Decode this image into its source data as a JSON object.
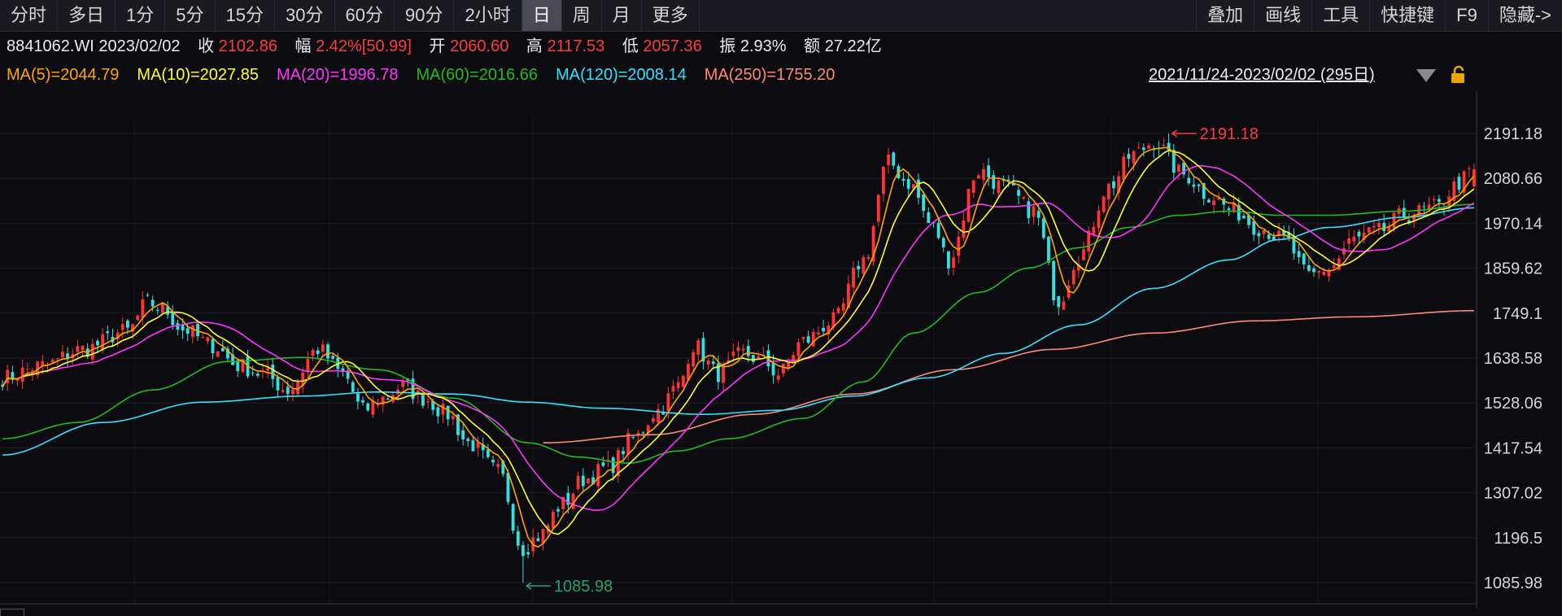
{
  "toolbar": {
    "periods": [
      "分时",
      "多日",
      "1分",
      "5分",
      "15分",
      "30分",
      "60分",
      "90分",
      "2小时",
      "日",
      "周",
      "月",
      "更多"
    ],
    "active_period": "日",
    "tools": [
      "叠加",
      "画线",
      "工具",
      "快捷键",
      "F9",
      "隐藏->"
    ]
  },
  "quote": {
    "code_date": "8841062.WI 2023/02/02",
    "close_label": "收",
    "close": "2102.86",
    "change_label": "幅",
    "change": "2.42%[50.99]",
    "open_label": "开",
    "open": "2060.60",
    "high_label": "高",
    "high": "2117.53",
    "low_label": "低",
    "low": "2057.36",
    "amp_label": "振",
    "amp": "2.93%",
    "amount_label": "额",
    "amount": "27.22亿"
  },
  "ma_labels": [
    {
      "text": "MA(5)=2044.79",
      "color": "#ffa500"
    },
    {
      "text": "MA(10)=2027.85",
      "color": "#ffff33"
    },
    {
      "text": "MA(20)=1996.78",
      "color": "#ff33ff"
    },
    {
      "text": "MA(60)=2016.66",
      "color": "#22bb22"
    },
    {
      "text": "MA(120)=2008.14",
      "color": "#33e0ff"
    },
    {
      "text": "MA(250)=1755.20",
      "color": "#ff8877"
    }
  ],
  "date_range": "2021/11/24-2023/02/02 (295日)",
  "chart_data": {
    "type": "candlestick",
    "y_ticks": [
      "2191.18",
      "2080.66",
      "1970.14",
      "1859.62",
      "1749.1",
      "1638.58",
      "1528.06",
      "1417.54",
      "1307.02",
      "1196.5",
      "1085.98"
    ],
    "ylim": [
      1085.98,
      2191.18
    ],
    "bar_count": 295,
    "high_annotation": "2191.18",
    "low_annotation": "1085.98",
    "colors": {
      "up": "#ff3333",
      "down": "#33e0e0",
      "ma5": "#ffa500",
      "ma10": "#ffff33",
      "ma20": "#ff33ff",
      "ma60": "#22bb22",
      "ma120": "#33e0ff",
      "ma250": "#ff8877"
    },
    "close_anchors": [
      [
        0,
        1590
      ],
      [
        8,
        1620
      ],
      [
        16,
        1660
      ],
      [
        25,
        1705
      ],
      [
        29,
        1775
      ],
      [
        32,
        1760
      ],
      [
        36,
        1710
      ],
      [
        42,
        1670
      ],
      [
        47,
        1620
      ],
      [
        52,
        1600
      ],
      [
        57,
        1560
      ],
      [
        63,
        1660
      ],
      [
        68,
        1600
      ],
      [
        72,
        1510
      ],
      [
        76,
        1540
      ],
      [
        80,
        1570
      ],
      [
        84,
        1540
      ],
      [
        89,
        1500
      ],
      [
        93,
        1430
      ],
      [
        99,
        1360
      ],
      [
        104,
        1170
      ],
      [
        107,
        1200
      ],
      [
        112,
        1280
      ],
      [
        116,
        1340
      ],
      [
        121,
        1370
      ],
      [
        126,
        1440
      ],
      [
        131,
        1510
      ],
      [
        135,
        1570
      ],
      [
        138,
        1670
      ],
      [
        143,
        1600
      ],
      [
        148,
        1650
      ],
      [
        152,
        1630
      ],
      [
        155,
        1600
      ],
      [
        160,
        1680
      ],
      [
        166,
        1730
      ],
      [
        172,
        1880
      ],
      [
        177,
        2120
      ],
      [
        181,
        2070
      ],
      [
        186,
        1960
      ],
      [
        189,
        1880
      ],
      [
        195,
        2100
      ],
      [
        200,
        2060
      ],
      [
        206,
        2000
      ],
      [
        211,
        1780
      ],
      [
        215,
        1890
      ],
      [
        221,
        2060
      ],
      [
        226,
        2140
      ],
      [
        230,
        2170
      ],
      [
        236,
        2090
      ],
      [
        241,
        2040
      ],
      [
        246,
        2000
      ],
      [
        251,
        1960
      ],
      [
        256,
        1930
      ],
      [
        261,
        1840
      ],
      [
        265,
        1860
      ],
      [
        270,
        1930
      ],
      [
        275,
        1950
      ],
      [
        280,
        1990
      ],
      [
        287,
        2010
      ],
      [
        290,
        2060
      ],
      [
        292,
        2080
      ],
      [
        294,
        2102.86
      ]
    ],
    "ma60_anchors": [
      [
        0,
        1440
      ],
      [
        15,
        1480
      ],
      [
        30,
        1560
      ],
      [
        45,
        1630
      ],
      [
        60,
        1640
      ],
      [
        75,
        1610
      ],
      [
        90,
        1540
      ],
      [
        105,
        1430
      ],
      [
        115,
        1395
      ],
      [
        125,
        1380
      ],
      [
        135,
        1410
      ],
      [
        145,
        1440
      ],
      [
        160,
        1490
      ],
      [
        172,
        1580
      ],
      [
        182,
        1700
      ],
      [
        195,
        1800
      ],
      [
        205,
        1860
      ],
      [
        215,
        1910
      ],
      [
        225,
        1960
      ],
      [
        235,
        1990
      ],
      [
        245,
        2000
      ],
      [
        255,
        1990
      ],
      [
        265,
        1990
      ],
      [
        280,
        2000
      ],
      [
        294,
        2016.66
      ]
    ],
    "ma120_anchors": [
      [
        0,
        1400
      ],
      [
        20,
        1480
      ],
      [
        40,
        1530
      ],
      [
        60,
        1545
      ],
      [
        75,
        1555
      ],
      [
        90,
        1550
      ],
      [
        105,
        1530
      ],
      [
        120,
        1515
      ],
      [
        140,
        1500
      ],
      [
        155,
        1510
      ],
      [
        170,
        1545
      ],
      [
        185,
        1590
      ],
      [
        200,
        1650
      ],
      [
        215,
        1720
      ],
      [
        230,
        1810
      ],
      [
        245,
        1880
      ],
      [
        255,
        1930
      ],
      [
        265,
        1960
      ],
      [
        280,
        1985
      ],
      [
        294,
        2008.14
      ]
    ],
    "ma250_anchors": [
      [
        108,
        1430
      ],
      [
        130,
        1450
      ],
      [
        150,
        1500
      ],
      [
        170,
        1550
      ],
      [
        190,
        1610
      ],
      [
        210,
        1660
      ],
      [
        230,
        1700
      ],
      [
        250,
        1730
      ],
      [
        270,
        1740
      ],
      [
        294,
        1755.2
      ]
    ]
  }
}
